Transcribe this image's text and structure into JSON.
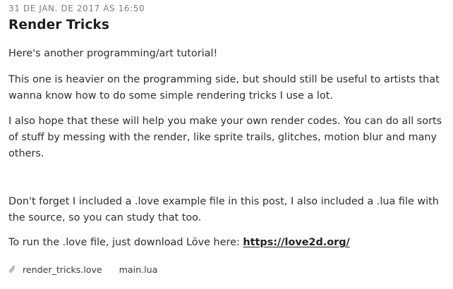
{
  "post": {
    "date": "31 DE JAN. DE 2017 ÀS 16:50",
    "title": "Render Tricks",
    "paragraphs": {
      "p1": "Here's another programming/art tutorial!",
      "p2": "This one is heavier on the programming side, but should still be useful to artists that wanna know how to do some simple rendering tricks I use a lot.",
      "p3": "I also hope that these will help you make your own render codes. You can do all sorts of stuff by messing with the render, like sprite trails, glitches, motion blur and many others.",
      "p4": "Don't forget I included a .love example file in this post, I also included a .lua file with the source, so you can study that too.",
      "p5_prefix": "To run the .love file, just download Löve here: ",
      "p5_link": "https://love2d.org/"
    },
    "attachments": {
      "icon": "paperclip-icon",
      "items": [
        "render_tricks.love",
        "main.lua"
      ]
    }
  }
}
